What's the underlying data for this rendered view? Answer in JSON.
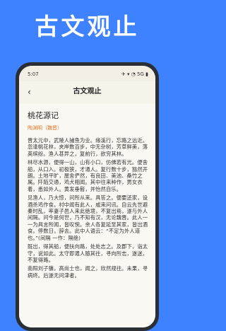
{
  "hero": {
    "title": "古文观止"
  },
  "status_bar": {
    "time": "5:07",
    "icons_text": "✈ ▾ ◔ 5G ▮"
  },
  "app_bar": {
    "back_icon": "chevron-left",
    "title": "古文观止"
  },
  "article": {
    "title": "桃花源记",
    "author": "陶渊明（魏晋）",
    "paragraphs": [
      "晋太元中，武陵人捕鱼为业。缘溪行，忘路之远近。忽逢桃花林，夹岸数百步，中无杂树，芳草鲜美，落英缤纷。渔人甚异之，复前行，欲穷其林。",
      "林尽水源，便得一山，山有小口，仿佛若有光。便舍船，从口入。初极狭，才通人。复行数十步，豁然开朗。土地平旷，屋舍俨然，有良田、美池、桑竹之属。阡陌交通，鸡犬相闻。其中往来种作，男女衣着，悉如外人。黄发垂髫，并怡然自乐。",
      "见渔人，乃大惊，问所从来。具答之。便要还家，设酒杀鸡作食。村中闻有此人，咸来问讯。自云先世避秦时乱，率妻子邑人来此绝境，不复出焉，遂与外人间隔。问今是何世，乃不知有汉，无论魏晋。此人一一为具言所闻，皆叹惋。余人各复延至其家，皆出酒食。停数日，辞去。此中人语云：“不足为外人道也。”(间隔 一作：隔绝)",
      "既出，得其船，便扶向路，处处志之。及郡下，诣太守，说如此。太守即遣人随其往，寻向所志，遂迷，不复得路。",
      "南阳刘子骥，高尚士也，闻之，欣然规往。未果，寻病终。后遂无问津者。"
    ]
  },
  "colors": {
    "background": "#3f82ff",
    "phone_frame": "#2a2f36",
    "author_accent": "#e07a2d",
    "content_background": "#faf8f2"
  }
}
